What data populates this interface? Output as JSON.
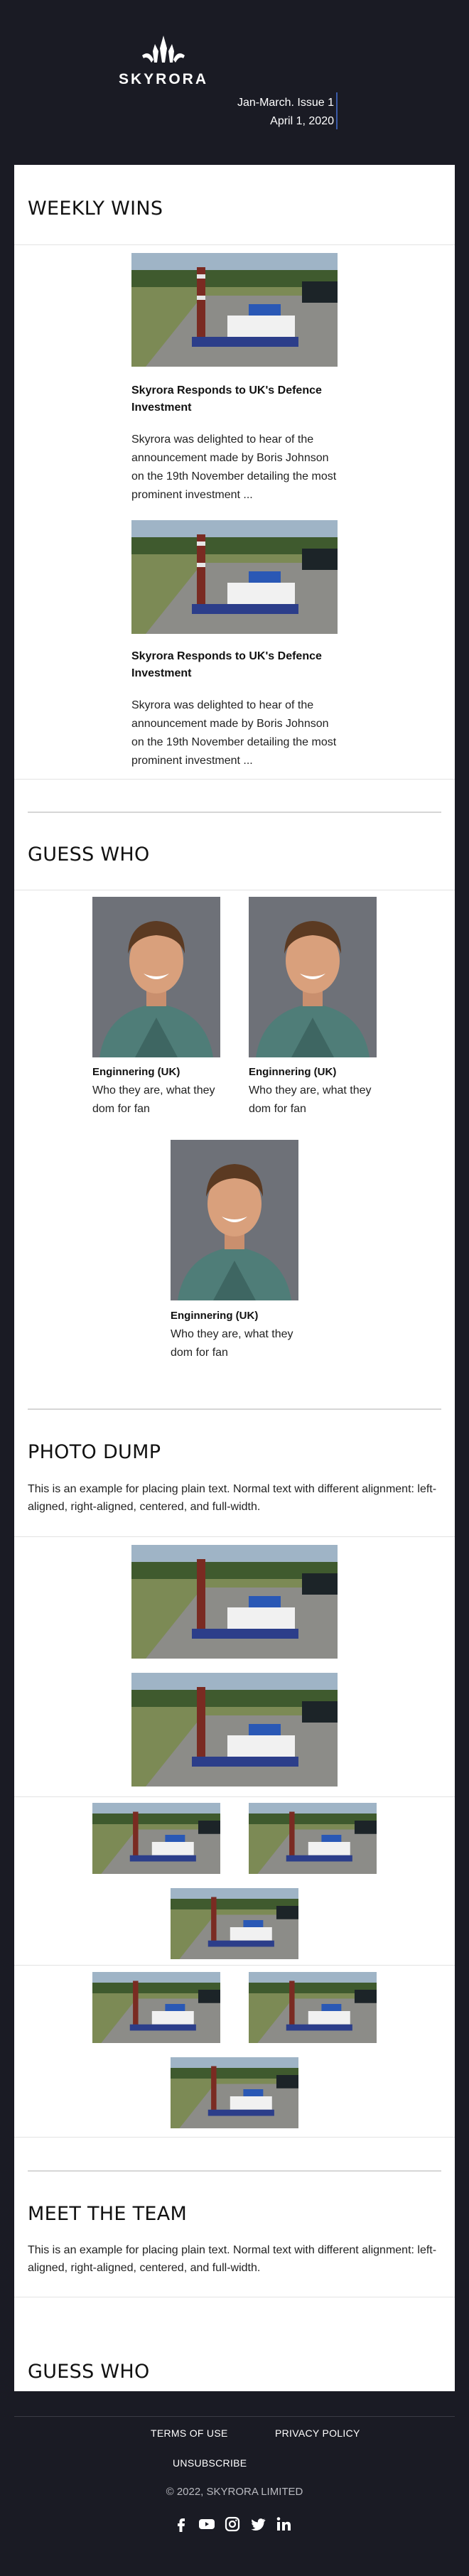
{
  "header": {
    "brand": "SKYRORA",
    "issue_line": "Jan-March. Issue 1",
    "date_line": "April 1, 2020"
  },
  "weekly_wins": {
    "title": "WEEKLY WINS",
    "articles": [
      {
        "headline": "Skyrora Responds to UK's Defence Investment",
        "body": "Skyrora was delighted to hear of the announcement made by Boris Johnson on the 19th November detailing the most prominent investment ..."
      },
      {
        "headline": "Skyrora Responds to UK's Defence Investment",
        "body": "Skyrora was delighted to hear of the announcement made by Boris Johnson on the 19th November detailing the most prominent investment ..."
      }
    ]
  },
  "guess_who": {
    "title": "GUESS  WHO",
    "people": [
      {
        "name": "Enginnering (UK)",
        "desc": "Who they are, what they dom for fan"
      },
      {
        "name": "Enginnering (UK)",
        "desc": "Who they are, what they dom for fan"
      },
      {
        "name": "Enginnering (UK)",
        "desc": "Who they are, what they dom for fan"
      }
    ]
  },
  "photo_dump": {
    "title": "PHOTO DUMP",
    "text": "This is an example for placing plain text. Normal text with different alignment: left-aligned, right-aligned, centered, and full-width."
  },
  "meet_team": {
    "title": "MEET THE TEAM",
    "text": "This is an example for placing plain text. Normal text with different alignment: left-aligned, right-aligned, centered, and full-width."
  },
  "guess_who_2": {
    "title": "GUESS  WHO"
  },
  "footer": {
    "terms": "TERMS OF USE",
    "privacy": "PRIVACY POLICY",
    "unsubscribe": "UNSUBSCRIBE",
    "copyright": "© 2022, SKYRORA LIMITED",
    "social_icons": [
      "facebook-icon",
      "youtube-icon",
      "instagram-icon",
      "twitter-icon",
      "linkedin-icon"
    ]
  },
  "colors": {
    "background": "#1a1b24",
    "card": "#ffffff",
    "accent_bar": "#3a5ba8"
  }
}
